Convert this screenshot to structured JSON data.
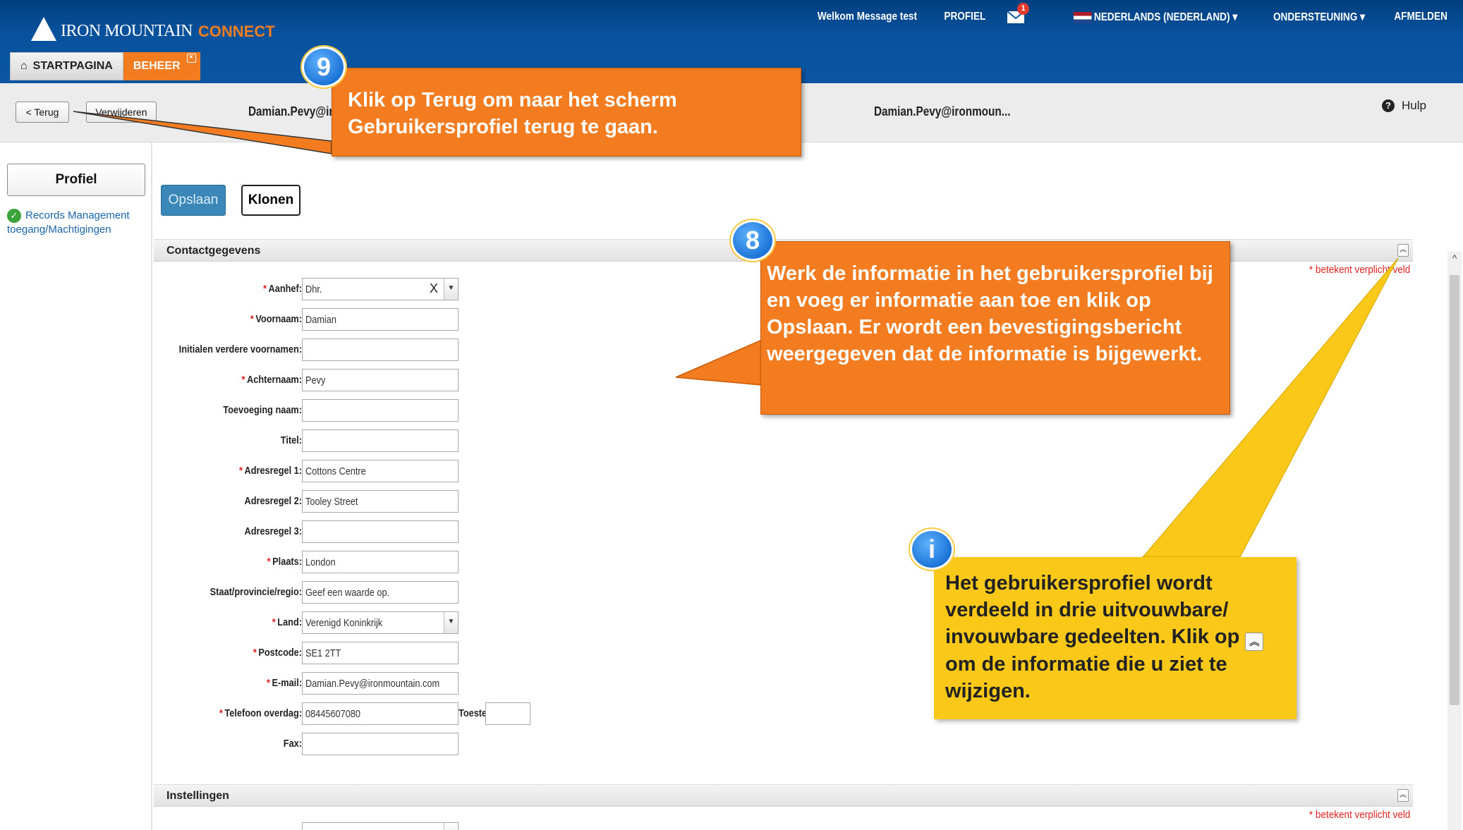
{
  "header": {
    "logo_brand": "IRON MOUNTAIN",
    "logo_product": "CONNECT",
    "welcome": "Welkom Message test",
    "profile": "PROFIEL",
    "mail_badge": "1",
    "language": "NEDERLANDS (NEDERLAND)",
    "support": "ONDERSTEUNING",
    "logout": "AFMELDEN",
    "tabs": [
      {
        "label": "STARTPAGINA"
      },
      {
        "label": "BEHEER"
      }
    ]
  },
  "toolbar": {
    "back": "< Terug",
    "delete": "Verwijderen",
    "user_left": "Damian.Pevy@ir",
    "user_center": "Damian.Pevy@ironmoun...",
    "help": "Hulp"
  },
  "sidebar": {
    "profile": "Profiel",
    "records_link": "Records Management toegang/Machtigingen"
  },
  "actions": {
    "save": "Opslaan",
    "clone": "Klonen"
  },
  "contact": {
    "title": "Contactgegevens",
    "required_note": "* betekent verplicht veld",
    "fields": [
      {
        "label": "Aanhef:",
        "required": true,
        "value": "Dhr."
      },
      {
        "label": "Voornaam:",
        "required": true,
        "value": "Damian"
      },
      {
        "label": "Initialen verdere voornamen:",
        "required": false,
        "value": ""
      },
      {
        "label": "Achternaam:",
        "required": true,
        "value": "Pevy"
      },
      {
        "label": "Toevoeging naam:",
        "required": false,
        "value": ""
      },
      {
        "label": "Titel:",
        "required": false,
        "value": ""
      },
      {
        "label": "Adresregel 1:",
        "required": true,
        "value": "Cottons Centre"
      },
      {
        "label": "Adresregel 2:",
        "required": false,
        "value": "Tooley Street"
      },
      {
        "label": "Adresregel 3:",
        "required": false,
        "value": ""
      },
      {
        "label": "Plaats:",
        "required": true,
        "value": "London"
      },
      {
        "label": "Staat/provincie/regio:",
        "required": false,
        "value": "Geef een waarde op."
      },
      {
        "label": "Land:",
        "required": true,
        "value": "Verenigd Koninkrijk"
      },
      {
        "label": "Postcode:",
        "required": true,
        "value": "SE1 2TT"
      },
      {
        "label": "E-mail:",
        "required": true,
        "value": "Damian.Pevy@ironmountain.com"
      },
      {
        "label": "Telefoon overdag:",
        "required": true,
        "value": "08445607080"
      },
      {
        "label": "Fax:",
        "required": false,
        "value": ""
      }
    ],
    "ext_label": "Toeste",
    "ext_value": ""
  },
  "settings": {
    "title": "Instellingen",
    "required_note": "* betekent verplicht veld"
  },
  "callouts": {
    "step9_number": "9",
    "step9_text": "Klik op Terug om naar het scherm Gebruikersprofiel terug te gaan.",
    "step8_number": "8",
    "step8_text": "Werk de informatie in het gebruikersprofiel bij en voeg er informatie aan toe en klik op Opslaan. Er wordt een bevestigingsbericht weergegeven dat de informatie is bijgewerkt.",
    "info_number": "i",
    "info_text_before": "Het gebruikersprofiel wordt verdeeld in drie uitvouwbare/ invouwbare gedeelten. Klik op",
    "info_text_after": "om de informatie die u ziet te wijzigen."
  },
  "colors": {
    "header_blue": "#0a56a3",
    "tab_orange": "#f37b20",
    "callout_orange": "#f47c20",
    "callout_yellow": "#fac818",
    "badge_blue": "#1c74d6",
    "required_red": "#e01f1f",
    "save_blue": "#3a87b8"
  },
  "icons": [
    "home-icon",
    "mail-icon",
    "flag-nl-icon",
    "chevron-down-icon",
    "help-icon",
    "check-icon",
    "collapse-icon",
    "clear-icon"
  ]
}
